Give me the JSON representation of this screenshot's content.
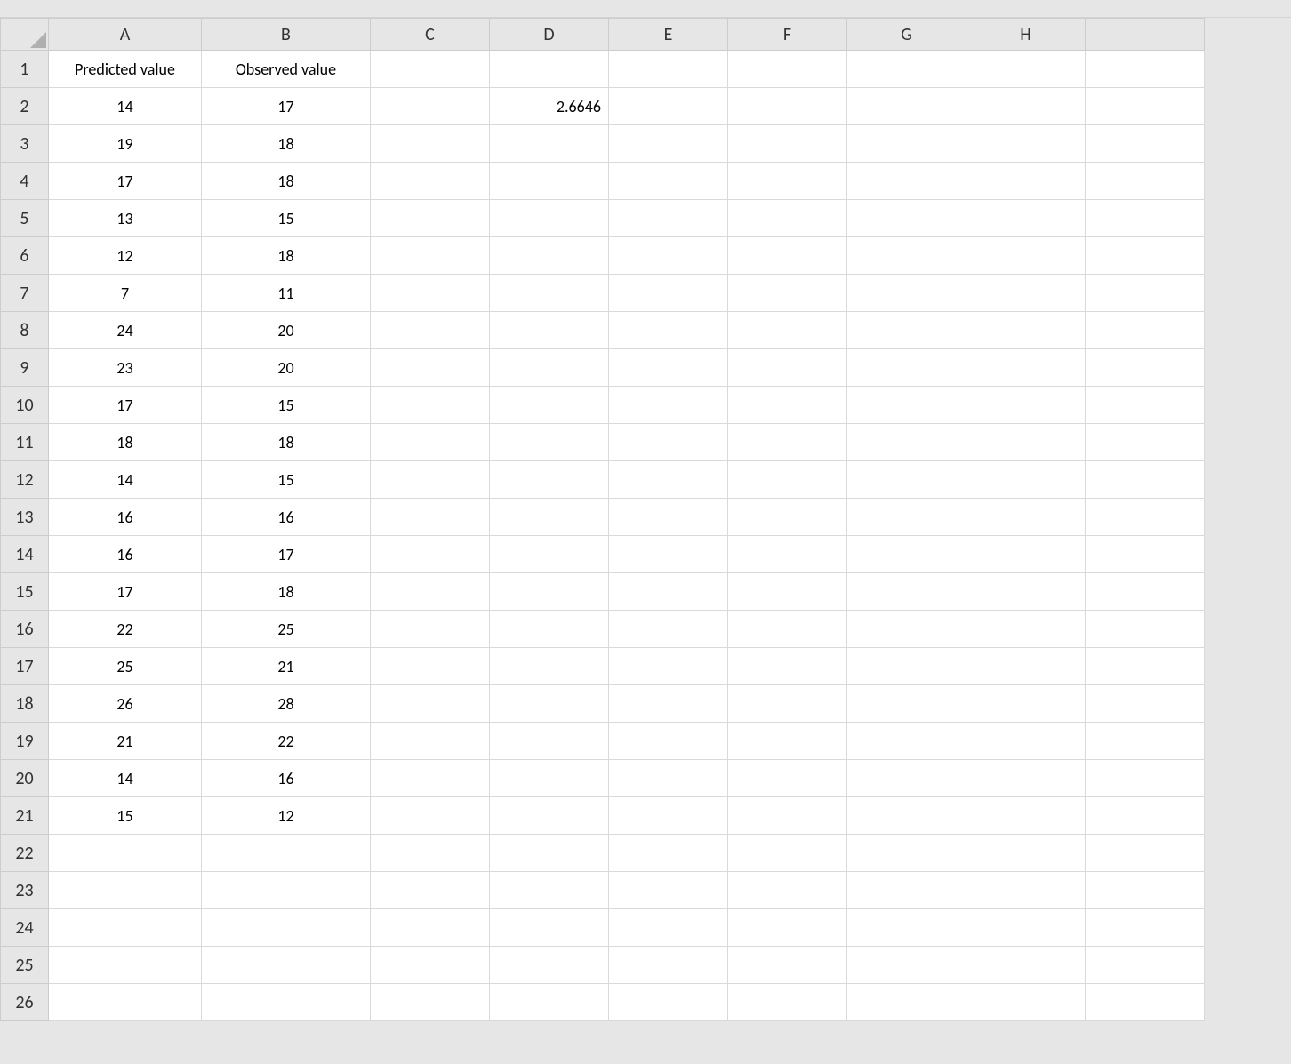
{
  "columns": [
    "A",
    "B",
    "C",
    "D",
    "E",
    "F",
    "G",
    "H"
  ],
  "row_count": 26,
  "headers": {
    "A1": "Predicted value",
    "B1": "Observed value"
  },
  "data": {
    "A": [
      "14",
      "19",
      "17",
      "13",
      "12",
      "7",
      "24",
      "23",
      "17",
      "18",
      "14",
      "16",
      "16",
      "17",
      "22",
      "25",
      "26",
      "21",
      "14",
      "15"
    ],
    "B": [
      "17",
      "18",
      "18",
      "15",
      "18",
      "11",
      "20",
      "20",
      "15",
      "18",
      "15",
      "16",
      "17",
      "18",
      "25",
      "21",
      "28",
      "22",
      "16",
      "12"
    ]
  },
  "other": {
    "D2": "2.6646"
  }
}
